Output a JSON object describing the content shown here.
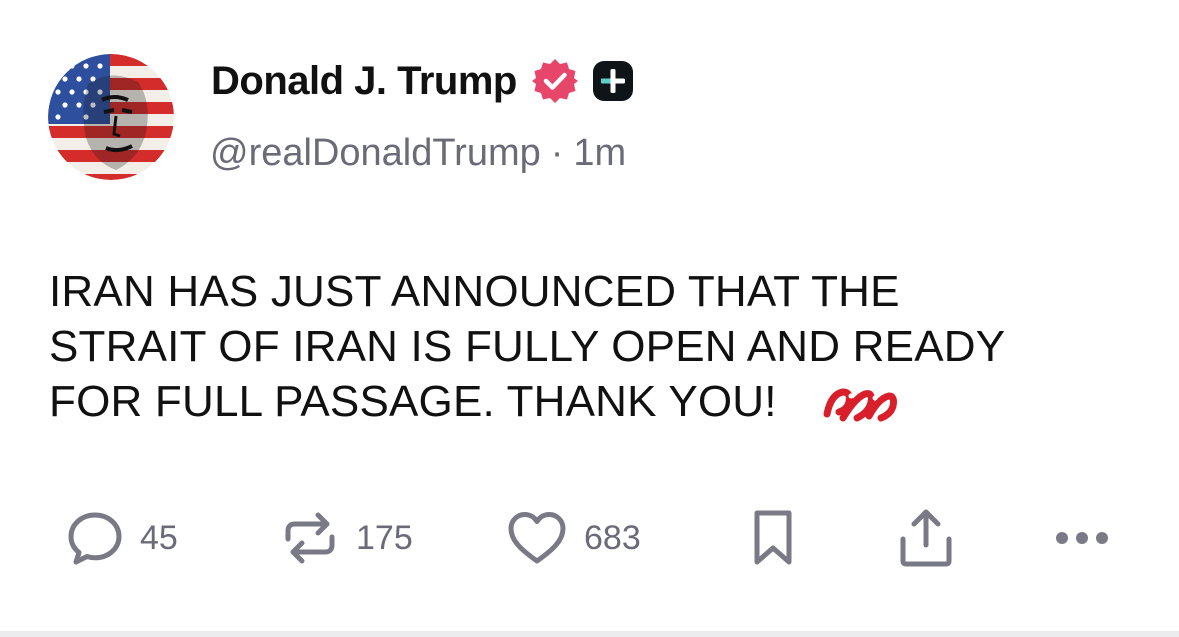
{
  "author": {
    "display_name": "Donald J. Trump",
    "handle": "@realDonaldTrump",
    "separator": "·",
    "timestamp": "1m",
    "verified_icon": "verified-badge-icon",
    "verified_color": "#e8456b",
    "plus_icon": "plus-badge-icon"
  },
  "post": {
    "lines": [
      "IRAN HAS JUST ANNOUNCED THAT THE",
      "STRAIT OF IRAN IS FULLY OPEN AND READY",
      "FOR FULL PASSAGE. THANK YOU!"
    ],
    "emoji_icon": "red-logo-icon"
  },
  "actions": {
    "reply": {
      "icon": "reply-bubble-icon",
      "count": "45"
    },
    "repost": {
      "icon": "repost-icon",
      "count": "175"
    },
    "like": {
      "icon": "heart-icon",
      "count": "683"
    },
    "bookmark": {
      "icon": "bookmark-icon"
    },
    "share": {
      "icon": "share-icon"
    },
    "more": {
      "icon": "more-dots-icon"
    }
  },
  "colors": {
    "text": "#111111",
    "muted": "#6b6b78",
    "icon": "#7a7a86",
    "accent_red": "#d81f2a"
  }
}
